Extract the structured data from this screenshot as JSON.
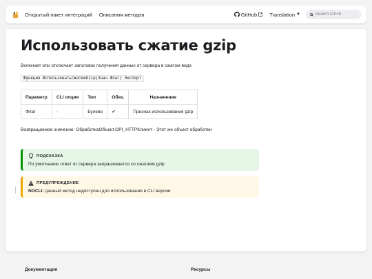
{
  "navbar": {
    "links": [
      "Открытый пакет интеграций",
      "Описания методов"
    ],
    "github_label": "GitHub",
    "translation_label": "Translation",
    "search_placeholder": "Search Ctrl+K"
  },
  "page": {
    "title": "Использовать сжатие gzip",
    "description": "Включает или отключает заголовок получения данных от сервера в сжатом виде",
    "signature": "Функция ИспользоватьСжатиеGzip(Знач Флаг) Экспорт",
    "table": {
      "headers": [
        "Параметр",
        "CLI опция",
        "Тип",
        "Обяз.",
        "Назначение"
      ],
      "rows": [
        [
          "Флаг",
          "-",
          "Булево",
          "✔",
          "Признак использования gzip"
        ]
      ]
    },
    "return_value": "Возвращаемое значение: ОбработкаОбъект.OPI_HTTPКлиент - Этот же объект обработки"
  },
  "tip": {
    "heading": "ПОДСКАЗКА",
    "body": "По умолчанию ответ от сервера запрашивается со сжатием gzip"
  },
  "warning": {
    "heading": "ПРЕДУПРЕЖДЕНИЕ",
    "strong": "NOCLI:",
    "body": " данный метод недоступен для использования в CLI версии"
  },
  "footer": {
    "col1": "Документация",
    "col2": "Ресурсы"
  },
  "colors": {
    "tip_border": "#009400",
    "tip_bg": "#e6f6e6",
    "warning_border": "#e6a700",
    "warning_bg": "#fff8e6"
  }
}
